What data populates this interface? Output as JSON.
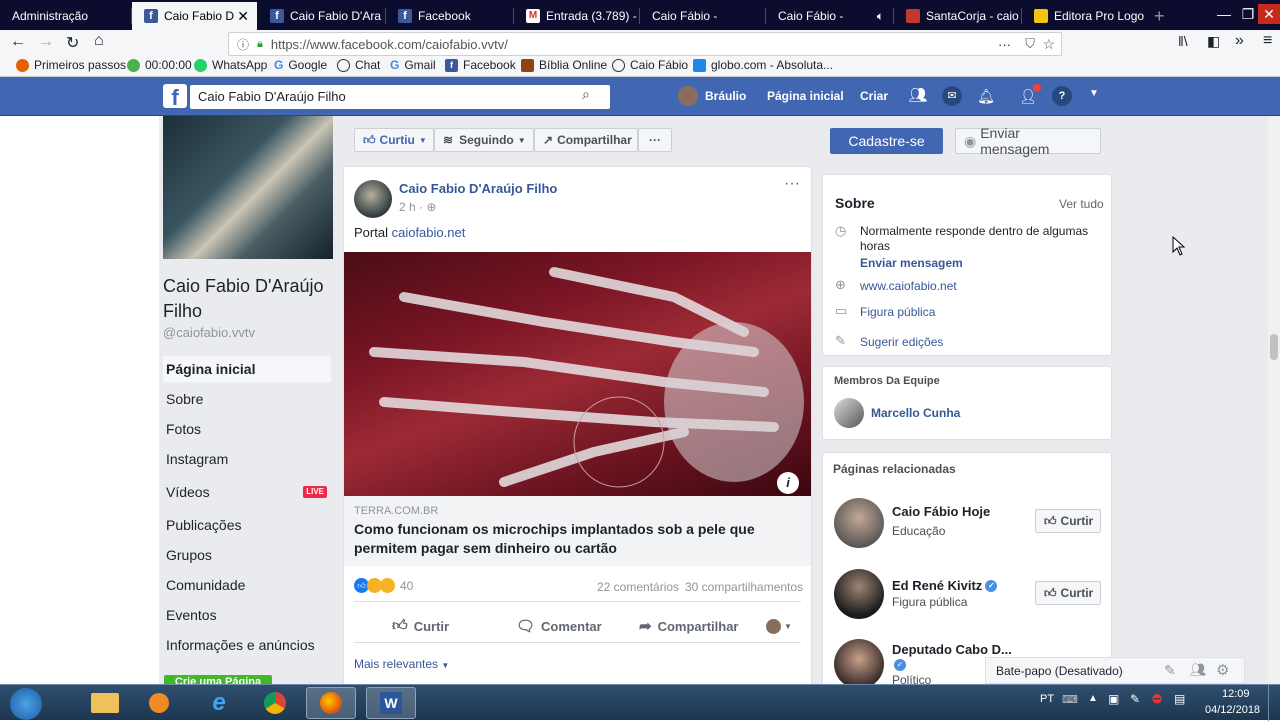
{
  "browser": {
    "tabs": [
      {
        "label": "Administração",
        "icon": "none"
      },
      {
        "label": "Caio Fabio D'Ar",
        "icon": "facebook"
      },
      {
        "label": "Caio Fabio D'Ara",
        "icon": "facebook"
      },
      {
        "label": "Facebook",
        "icon": "facebook"
      },
      {
        "label": "Entrada (3.789) -",
        "icon": "gmail"
      },
      {
        "label": "Caio Fábio -",
        "icon": "none"
      },
      {
        "label": "Caio Fábio -",
        "icon": "speaker"
      },
      {
        "label": "SantaCorja - caio",
        "icon": "santacorja"
      },
      {
        "label": "Editora Pro Logo",
        "icon": "folder"
      }
    ],
    "new_tab": "+",
    "url": "https://www.facebook.com/caiofabio.vvtv/",
    "bookmarks": [
      "Primeiros passos",
      "00:00:00",
      "WhatsApp",
      "Google",
      "Chat",
      "Gmail",
      "Facebook",
      "Bíblia Online",
      "Caio Fábio",
      "globo.com - Absoluta..."
    ]
  },
  "fb_header": {
    "search_value": "Caio Fabio D'Araújo Filho",
    "user": "Bráulio",
    "home": "Página inicial",
    "create": "Criar"
  },
  "profile": {
    "name": "Caio Fabio D'Araújo Filho",
    "handle": "@caiofabio.vvtv",
    "nav": [
      "Página inicial",
      "Sobre",
      "Fotos",
      "Instagram",
      "Vídeos",
      "Publicações",
      "Grupos",
      "Comunidade",
      "Eventos",
      "Informações e anúncios"
    ],
    "live_badge": "LIVE",
    "create_page_partial": "Crie uma Página"
  },
  "actions": {
    "liked": "Curtiu",
    "following": "Seguindo",
    "share": "Compartilhar",
    "more": "···",
    "signup": "Cadastre-se",
    "send_message": "Enviar mensagem"
  },
  "post": {
    "author": "Caio Fabio D'Araújo Filho",
    "time": "2 h ·",
    "text_prefix": "Portal",
    "text_link": "caiofabio.net",
    "link_domain": "TERRA.COM.BR",
    "link_title": "Como funcionam os microchips implantados sob a pele que permitem pagar sem dinheiro ou cartão",
    "reactions_count": "40",
    "comments": "22 comentários",
    "shares": "30 compartilhamentos",
    "btn_like": "Curtir",
    "btn_comment": "Comentar",
    "btn_share": "Compartilhar",
    "most_relevant": "Mais relevantes"
  },
  "about": {
    "title": "Sobre",
    "see_all": "Ver tudo",
    "response": "Normalmente responde dentro de algumas horas",
    "send_message": "Enviar mensagem",
    "website": "www.caiofabio.net",
    "category": "Figura pública",
    "suggest": "Sugerir edições"
  },
  "team": {
    "title": "Membros Da Equipe",
    "member": "Marcello Cunha"
  },
  "related": {
    "title": "Páginas relacionadas",
    "pages": [
      {
        "name": "Caio Fábio Hoje",
        "category": "Educação",
        "button": "Curtir"
      },
      {
        "name": "Ed René Kivitz",
        "category": "Figura pública",
        "button": "Curtir"
      },
      {
        "name": "Deputado Cabo D...",
        "category": "Político",
        "button": ""
      }
    ]
  },
  "chat": {
    "label": "Bate-papo (Desativado)"
  },
  "taskbar": {
    "lang": "PT",
    "time": "12:09",
    "date": "04/12/2018"
  }
}
